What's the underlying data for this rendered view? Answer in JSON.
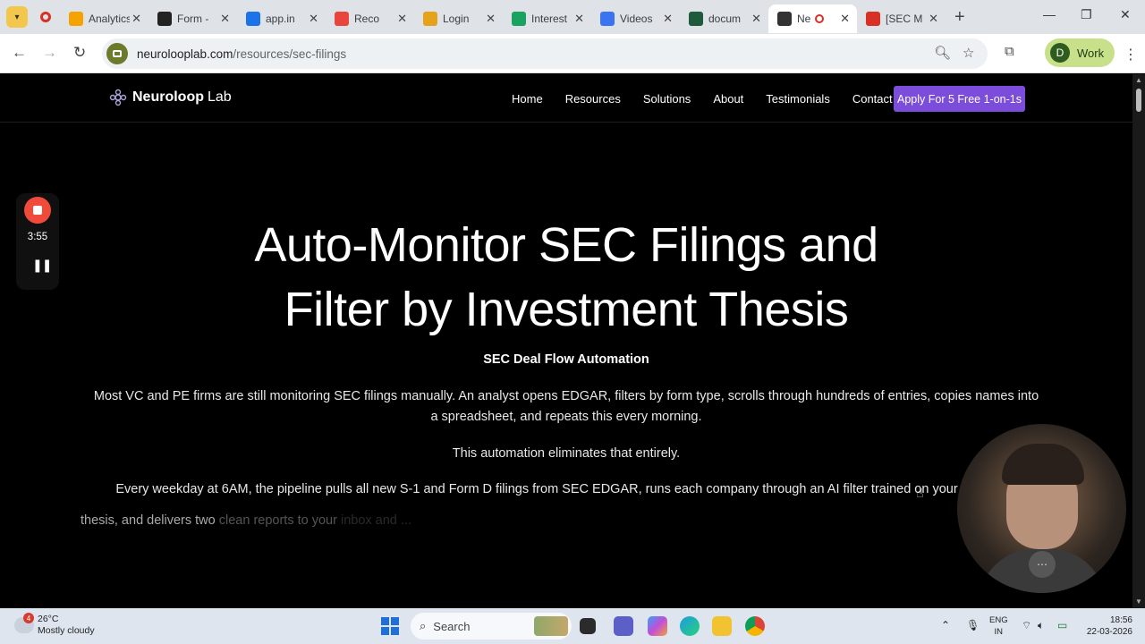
{
  "browser": {
    "tabs": [
      {
        "label": "Analytics",
        "color": "#f4a300"
      },
      {
        "label": "Form -",
        "color": "#222222"
      },
      {
        "label": "app.in",
        "color": "#1a73e8"
      },
      {
        "label": "Reco",
        "color": "#e8453c"
      },
      {
        "label": "Login",
        "color": "#e7a21c"
      },
      {
        "label": "Interest",
        "color": "#1aa260"
      },
      {
        "label": "Videos",
        "color": "#3b74f0"
      },
      {
        "label": "docum",
        "color": "#1e5b3a"
      },
      {
        "label": "Ne",
        "color": "#333333"
      },
      {
        "label": "[SEC M",
        "color": "#d93025"
      }
    ],
    "url_host": "neurolooplab.com",
    "url_path": "/resources/sec-filings",
    "profile_initial": "D",
    "profile_label": "Work"
  },
  "site": {
    "logo_bold": "Neuroloop",
    "logo_light": "Lab",
    "nav": [
      "Home",
      "Resources",
      "Solutions",
      "About",
      "Testimonials",
      "Contact"
    ],
    "cta": "Apply For 5 Free 1-on-1s"
  },
  "hero": {
    "title_line1": "Auto-Monitor SEC Filings and",
    "title_line2": "Filter by Investment Thesis",
    "subhead": "SEC Deal Flow Automation",
    "para1": "Most VC and PE firms are still monitoring SEC filings manually. An analyst opens EDGAR, filters by form type, scrolls through hundreds of entries, copies names into a spreadsheet, and repeats this every morning.",
    "para2": "This automation eliminates that entirely.",
    "para3": "Every weekday at 6AM, the pipeline pulls all new S-1 and Form D filings from SEC EDGAR, runs each company through an AI filter trained on your",
    "para4_a": "thesis, and delivers two",
    "para4_b": "clean reports to your",
    "para4_c": "inbox and ..."
  },
  "recorder": {
    "time": "3:55"
  },
  "taskbar": {
    "weather_badge": "4",
    "temp": "26°C",
    "condition": "Mostly cloudy",
    "search": "Search",
    "lang1": "ENG",
    "lang2": "IN",
    "time": "18:56",
    "date": "22-03-2026"
  },
  "colors": {
    "accent": "#7c4ddb",
    "page_bg": "#000000",
    "record": "#f04a3a"
  }
}
